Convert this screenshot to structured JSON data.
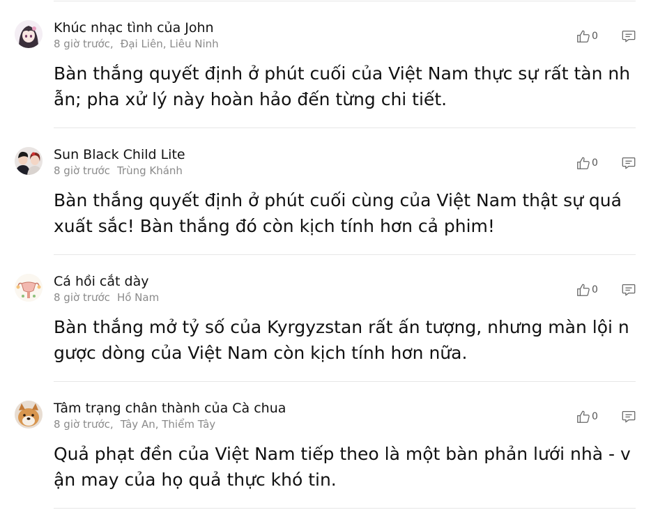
{
  "comments": [
    {
      "username": "Khúc nhạc tình của John",
      "time": "8 giờ trước,",
      "location": "Đại Liên, Liêu Ninh",
      "likes": "0",
      "text": "Bàn thắng quyết định ở phút cuối của Việt Nam thực sự rất tàn nhẫn; pha xử lý này hoàn hảo đến từng chi tiết.",
      "avatar": "anime-girl-avatar"
    },
    {
      "username": "Sun Black Child Lite",
      "time": "8 giờ trước",
      "location": "Trùng Khánh",
      "likes": "0",
      "text": "Bàn thắng quyết định ở phút cuối cùng của Việt Nam thật sự quá xuất sắc! Bàn thắng đó còn kịch tính hơn cả phim!",
      "avatar": "couple-avatar"
    },
    {
      "username": "Cá hồi cắt dày",
      "time": "8 giờ trước",
      "location": "Hồ Nam",
      "likes": "0",
      "text": "Bàn thắng mở tỷ số của Kyrgyzstan rất ấn tượng, nhưng màn lội ngược dòng của Việt Nam còn kịch tính hơn nữa.",
      "avatar": "illustration-avatar"
    },
    {
      "username": "Tâm trạng chân thành của Cà chua",
      "time": "8 giờ trước,",
      "location": "Tây An, Thiểm Tây",
      "likes": "0",
      "text": "Quả phạt đền của Việt Nam tiếp theo là một bàn phản lưới nhà - vận may của họ quả thực khó tin.",
      "avatar": "dog-avatar"
    }
  ]
}
